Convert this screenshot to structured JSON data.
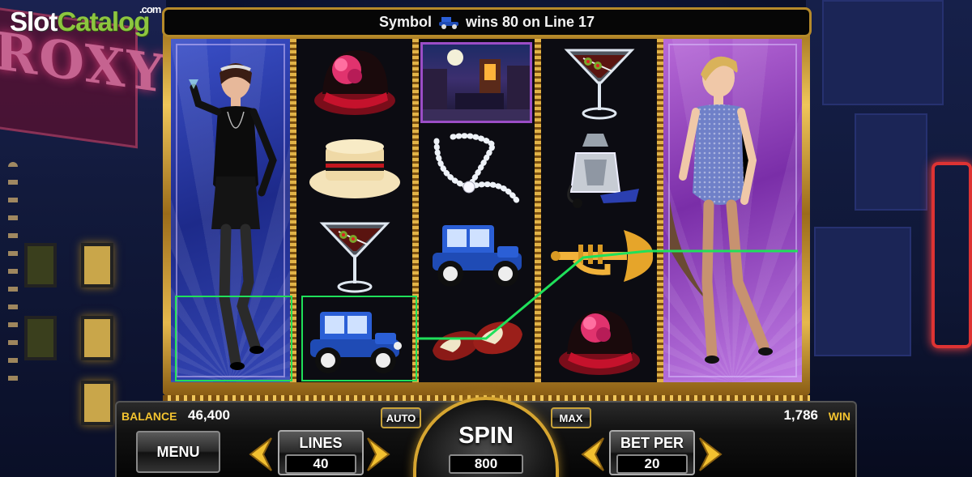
{
  "logo": {
    "slot": "Slot",
    "catalog": "Catalog",
    "com": ".com"
  },
  "message": {
    "prefix": "Symbol",
    "suffix": "wins 80 on Line 17",
    "symbol_icon": "blue-car-icon"
  },
  "reels": {
    "reel1": {
      "wild": "flapper-woman-black-dress"
    },
    "reel2": [
      "red-cloche-hat",
      "straw-boater-hat",
      "martini-glass",
      "blue-vintage-car"
    ],
    "reel3": [
      "city-night-scene",
      "pearl-necklace",
      "blue-vintage-car",
      "two-tone-shoes"
    ],
    "reel4": [
      "martini-glass",
      "perfume-bottle",
      "trumpet",
      "red-cloche-hat"
    ],
    "reel5": {
      "wild": "flapper-woman-blue-dress"
    }
  },
  "win_line": {
    "number": 17,
    "color": "#1fe05a"
  },
  "panel": {
    "balance_label": "BALANCE",
    "balance_value": "46,400",
    "win_label": "WIN",
    "win_value": "1,786",
    "menu_label": "MENU",
    "auto_label": "AUTO",
    "max_label": "MAX",
    "spin_label": "SPIN",
    "total_bet": "800",
    "lines_label": "LINES",
    "lines_value": "40",
    "bet_per_label": "BET PER",
    "bet_per_value": "20"
  },
  "colors": {
    "gold": "#f4c430",
    "frame": "#e2b347",
    "highlight": "#1fe05a"
  }
}
